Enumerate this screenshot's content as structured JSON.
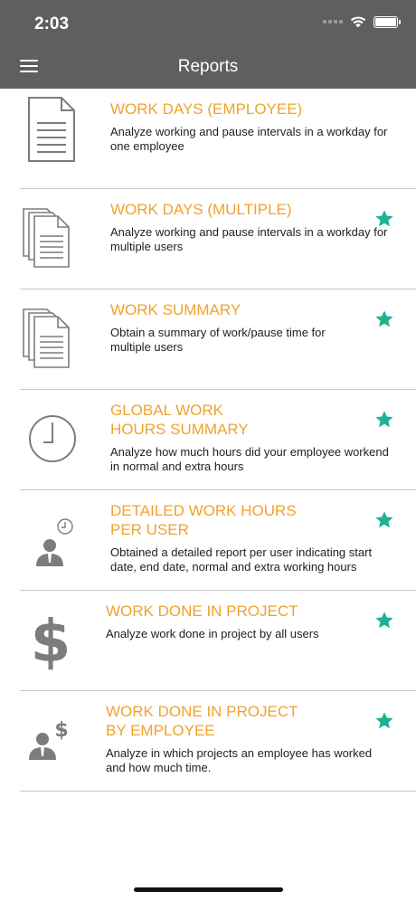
{
  "status_bar": {
    "time": "2:03"
  },
  "header": {
    "title": "Reports"
  },
  "colors": {
    "header_bg": "#5e5f5e",
    "title_color": "#f0a22c",
    "star_color": "#1fb193",
    "icon_color": "#7c7c7c"
  },
  "reports": [
    {
      "icon": "document-icon",
      "title_lines": [
        "WORK DAYS (EMPLOYEE)"
      ],
      "description_lines": [
        "Analyze working and pause intervals in a workday for",
        "one employee"
      ],
      "starred": false
    },
    {
      "icon": "documents-stack-icon",
      "title_lines": [
        "WORK DAYS (MULTIPLE)"
      ],
      "description_lines": [
        "Analyze working and pause intervals in a workday for",
        "multiple users"
      ],
      "starred": true
    },
    {
      "icon": "documents-stack-icon",
      "title_lines": [
        "WORK SUMMARY"
      ],
      "description_lines": [
        "Obtain a summary of work/pause time for",
        "multiple users"
      ],
      "starred": true
    },
    {
      "icon": "clock-icon",
      "title_lines": [
        "GLOBAL WORK",
        "HOURS SUMMARY"
      ],
      "description_lines": [
        "Analyze how much hours did your employee workend",
        "in normal and extra hours"
      ],
      "starred": true
    },
    {
      "icon": "user-clock-icon",
      "title_lines": [
        "DETAILED WORK HOURS",
        "PER USER"
      ],
      "description_lines": [
        "Obtained a detailed report per user indicating start",
        "date, end date, normal and extra working hours"
      ],
      "starred": true
    },
    {
      "icon": "dollar-icon",
      "title_lines": [
        "WORK DONE IN PROJECT"
      ],
      "description_lines": [
        "Analyze work done in project by all users"
      ],
      "starred": true
    },
    {
      "icon": "user-dollar-icon",
      "title_lines": [
        "WORK DONE IN PROJECT",
        "BY EMPLOYEE"
      ],
      "description_lines": [
        "Analyze in which projects an employee has worked",
        "and how much time."
      ],
      "starred": true
    }
  ]
}
